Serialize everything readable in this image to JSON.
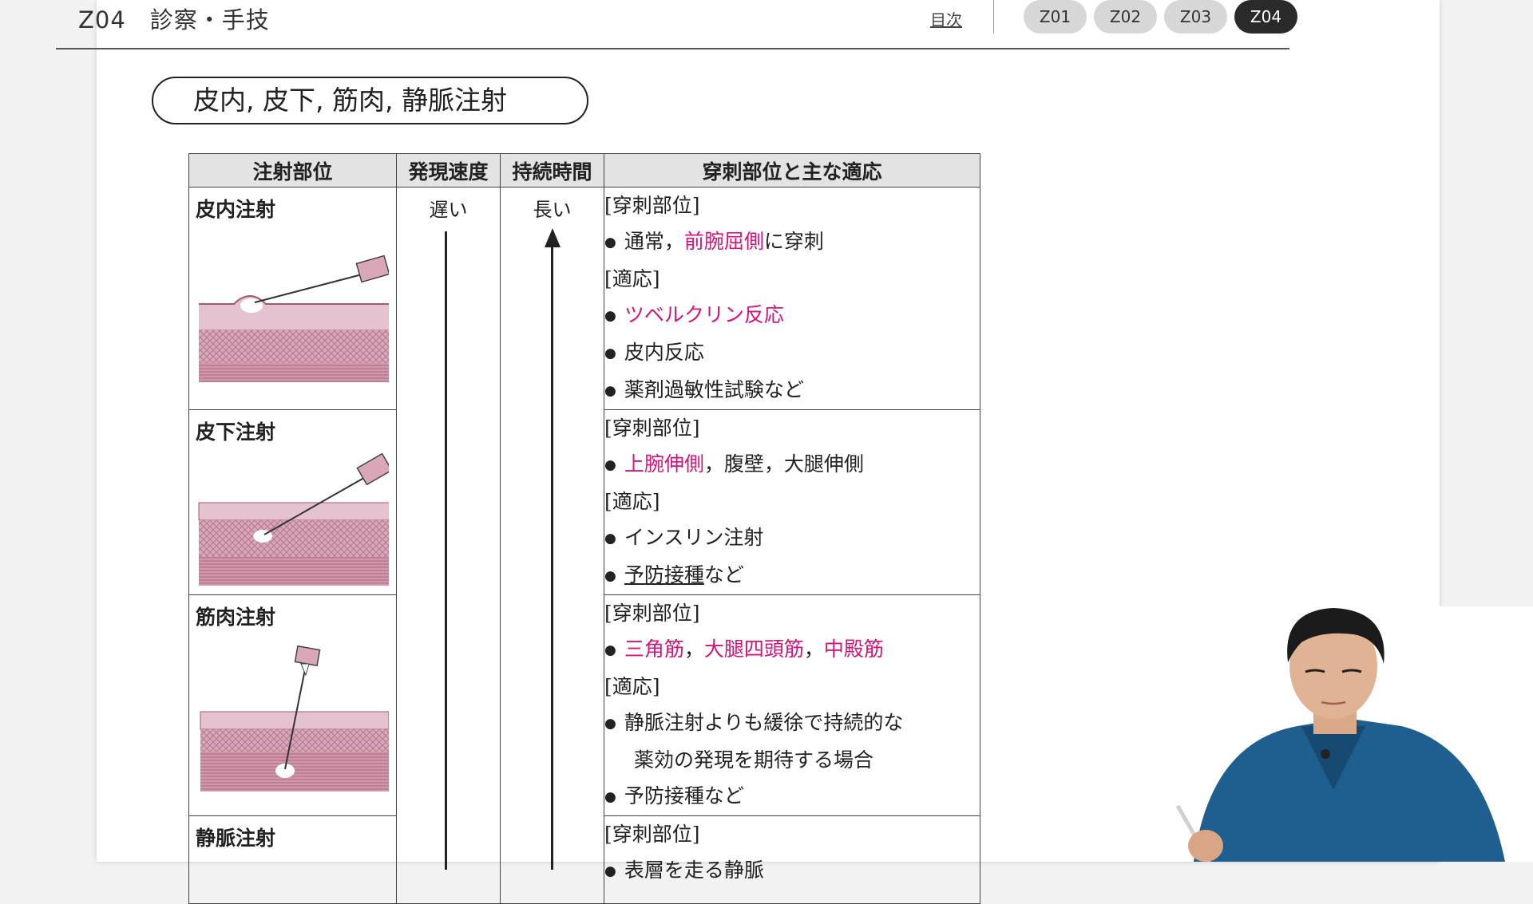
{
  "header": {
    "title": "Z04　診察・手技",
    "toc_link": "目次",
    "chips": [
      "Z01",
      "Z02",
      "Z03",
      "Z04"
    ],
    "active_chip": "Z04"
  },
  "section_title": "皮内, 皮下, 筋肉, 静脈注射",
  "table": {
    "columns": [
      "注射部位",
      "発現速度",
      "持続時間",
      "穿刺部位と主な適応"
    ],
    "speed_label": "遅い",
    "duration_label": "長い",
    "tag_site": "[穿刺部位]",
    "tag_indication": "[適応]",
    "rows": [
      {
        "site": "皮内注射",
        "site_parts": [
          {
            "pre": "通常，",
            "hl": "前腕屈側",
            "post": "に穿刺"
          }
        ],
        "indications": [
          {
            "hl": "ツベルクリン反応",
            "text": ""
          },
          {
            "hl": "",
            "text": "皮内反応"
          },
          {
            "hl": "",
            "text": "薬剤過敏性試験など"
          }
        ]
      },
      {
        "site": "皮下注射",
        "site_parts": [
          {
            "pre": "",
            "hl": "上腕伸側",
            "post": "，腹壁，大腿伸側"
          }
        ],
        "indications": [
          {
            "hl": "",
            "text": "インスリン注射"
          },
          {
            "hl": "",
            "ul": "予防接種",
            "text": "など"
          }
        ]
      },
      {
        "site": "筋肉注射",
        "site_parts_hl": [
          "三角筋",
          "大腿四頭筋",
          "中殿筋"
        ],
        "indications": [
          {
            "hl": "",
            "text": "静脈注射よりも緩徐で持続的な"
          },
          {
            "hl": "",
            "text": "薬効の発現を期待する場合",
            "cont": true
          },
          {
            "hl": "",
            "text": "予防接種など"
          }
        ]
      },
      {
        "site": "静脈注射",
        "site_parts": [
          {
            "pre": "表層を走る静脈",
            "hl": "",
            "post": ""
          }
        ]
      }
    ]
  },
  "colors": {
    "highlight": "#d4147a",
    "skin_pink": "#d8a4b4",
    "scrub_blue": "#1f5f8f"
  }
}
